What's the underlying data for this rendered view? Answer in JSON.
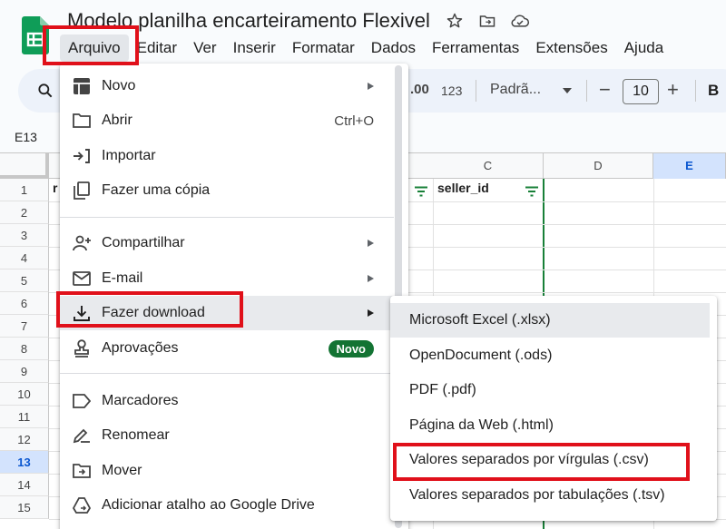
{
  "document": {
    "title": "Modelo planilha encarteiramento Flexivel"
  },
  "menubar": {
    "items": [
      "Arquivo",
      "Editar",
      "Ver",
      "Inserir",
      "Formatar",
      "Dados",
      "Ferramentas",
      "Extensões",
      "Ajuda"
    ]
  },
  "toolbar": {
    "decimal_label": ".00",
    "format_label": "123",
    "font_name": "Padrã...",
    "font_size": "10",
    "bold_label": "B",
    "minus": "−",
    "plus": "+"
  },
  "formula_bar": {
    "name_box": "E13"
  },
  "grid": {
    "columns": [
      "C",
      "D",
      "E"
    ],
    "selected_column": "E",
    "rows": [
      "1",
      "2",
      "3",
      "4",
      "5",
      "6",
      "7",
      "8",
      "9",
      "10",
      "11",
      "12",
      "13",
      "14",
      "15"
    ],
    "selected_row": "13",
    "cells": {
      "A1": "r",
      "C1": "seller_id"
    }
  },
  "file_menu": {
    "items": [
      {
        "label": "Novo",
        "icon": "grid-icon",
        "submenu": true
      },
      {
        "label": "Abrir",
        "icon": "folder-icon",
        "shortcut": "Ctrl+O"
      },
      {
        "label": "Importar",
        "icon": "import-icon"
      },
      {
        "label": "Fazer uma cópia",
        "icon": "copy-icon"
      },
      {
        "label": "Compartilhar",
        "icon": "person-add-icon",
        "submenu": true
      },
      {
        "label": "E-mail",
        "icon": "mail-icon",
        "submenu": true
      },
      {
        "label": "Fazer download",
        "icon": "download-icon",
        "submenu": true
      },
      {
        "label": "Aprovações",
        "icon": "approval-icon",
        "badge": "Novo"
      },
      {
        "label": "Marcadores",
        "icon": "label-icon"
      },
      {
        "label": "Renomear",
        "icon": "rename-icon"
      },
      {
        "label": "Mover",
        "icon": "move-icon"
      },
      {
        "label": "Adicionar atalho ao Google Drive",
        "icon": "drive-shortcut-icon"
      }
    ]
  },
  "download_submenu": {
    "items": [
      "Microsoft Excel (.xlsx)",
      "OpenDocument (.ods)",
      "PDF (.pdf)",
      "Página da Web (.html)",
      "Valores separados por vírgulas (.csv)",
      "Valores separados por tabulações (.tsv)"
    ]
  },
  "colors": {
    "highlight_red": "#e0101a",
    "badge_green": "#137333",
    "sheets_green": "#0f9d58"
  }
}
